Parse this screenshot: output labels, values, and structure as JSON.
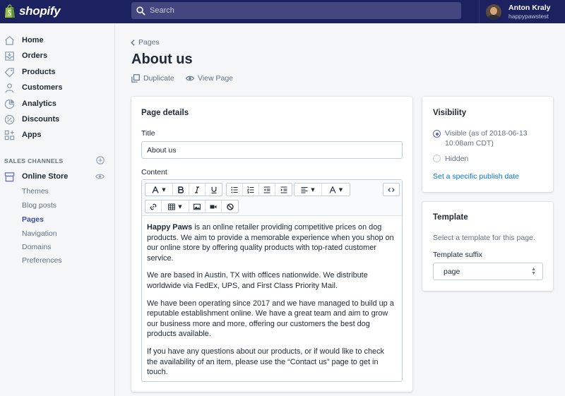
{
  "topbar": {
    "logo_text": "shopify",
    "search_placeholder": "Search",
    "user_name": "Anton Kraly",
    "user_store": "happypawstest"
  },
  "sidebar": {
    "items": [
      {
        "label": "Home",
        "icon": "home-icon"
      },
      {
        "label": "Orders",
        "icon": "orders-icon"
      },
      {
        "label": "Products",
        "icon": "tag-icon"
      },
      {
        "label": "Customers",
        "icon": "person-icon"
      },
      {
        "label": "Analytics",
        "icon": "chart-icon"
      },
      {
        "label": "Discounts",
        "icon": "discount-icon"
      },
      {
        "label": "Apps",
        "icon": "apps-icon"
      }
    ],
    "sales_channels_label": "SALES CHANNELS",
    "online_store_label": "Online Store",
    "sub_items": [
      "Themes",
      "Blog posts",
      "Pages",
      "Navigation",
      "Domains",
      "Preferences"
    ],
    "active_sub_item": "Pages"
  },
  "main": {
    "breadcrumb": "Pages",
    "title": "About us",
    "actions": {
      "duplicate": "Duplicate",
      "view_page": "View Page"
    },
    "page_details": {
      "card_title": "Page details",
      "title_label": "Title",
      "title_value": "About us",
      "content_label": "Content",
      "content": {
        "p1_bold": "Happy Paws",
        "p1_rest": " is an online retailer providing competitive prices on dog products.  We aim to provide a memorable experience when you shop on our online store by offering quality products with top-rated customer service.",
        "p2": "We are based in Austin, TX with offices nationwide. We distribute worldwide via FedEx, UPS, and First Class Priority Mail.",
        "p3": "We have been operating since 2017 and we have managed to build up a reputable establishment online. We have a great team and aim to grow our business more and more, offering our customers the best dog products available.",
        "p4": "If you have any questions about our products, or if would like to check the availability of an item, please use the “Contact us” page to get in touch."
      }
    },
    "visibility": {
      "card_title": "Visibility",
      "visible_label": "Visible (as of 2018-06-13 10:08am CDT)",
      "visible_selected": true,
      "hidden_label": "Hidden",
      "publish_date_link": "Set a specific publish date"
    },
    "template": {
      "card_title": "Template",
      "description": "Select a template for this page.",
      "suffix_label": "Template suffix",
      "suffix_value": "page"
    }
  },
  "colors": {
    "topbar": "#1c2260",
    "link": "#007ace",
    "radio": "#5c6ac4"
  }
}
